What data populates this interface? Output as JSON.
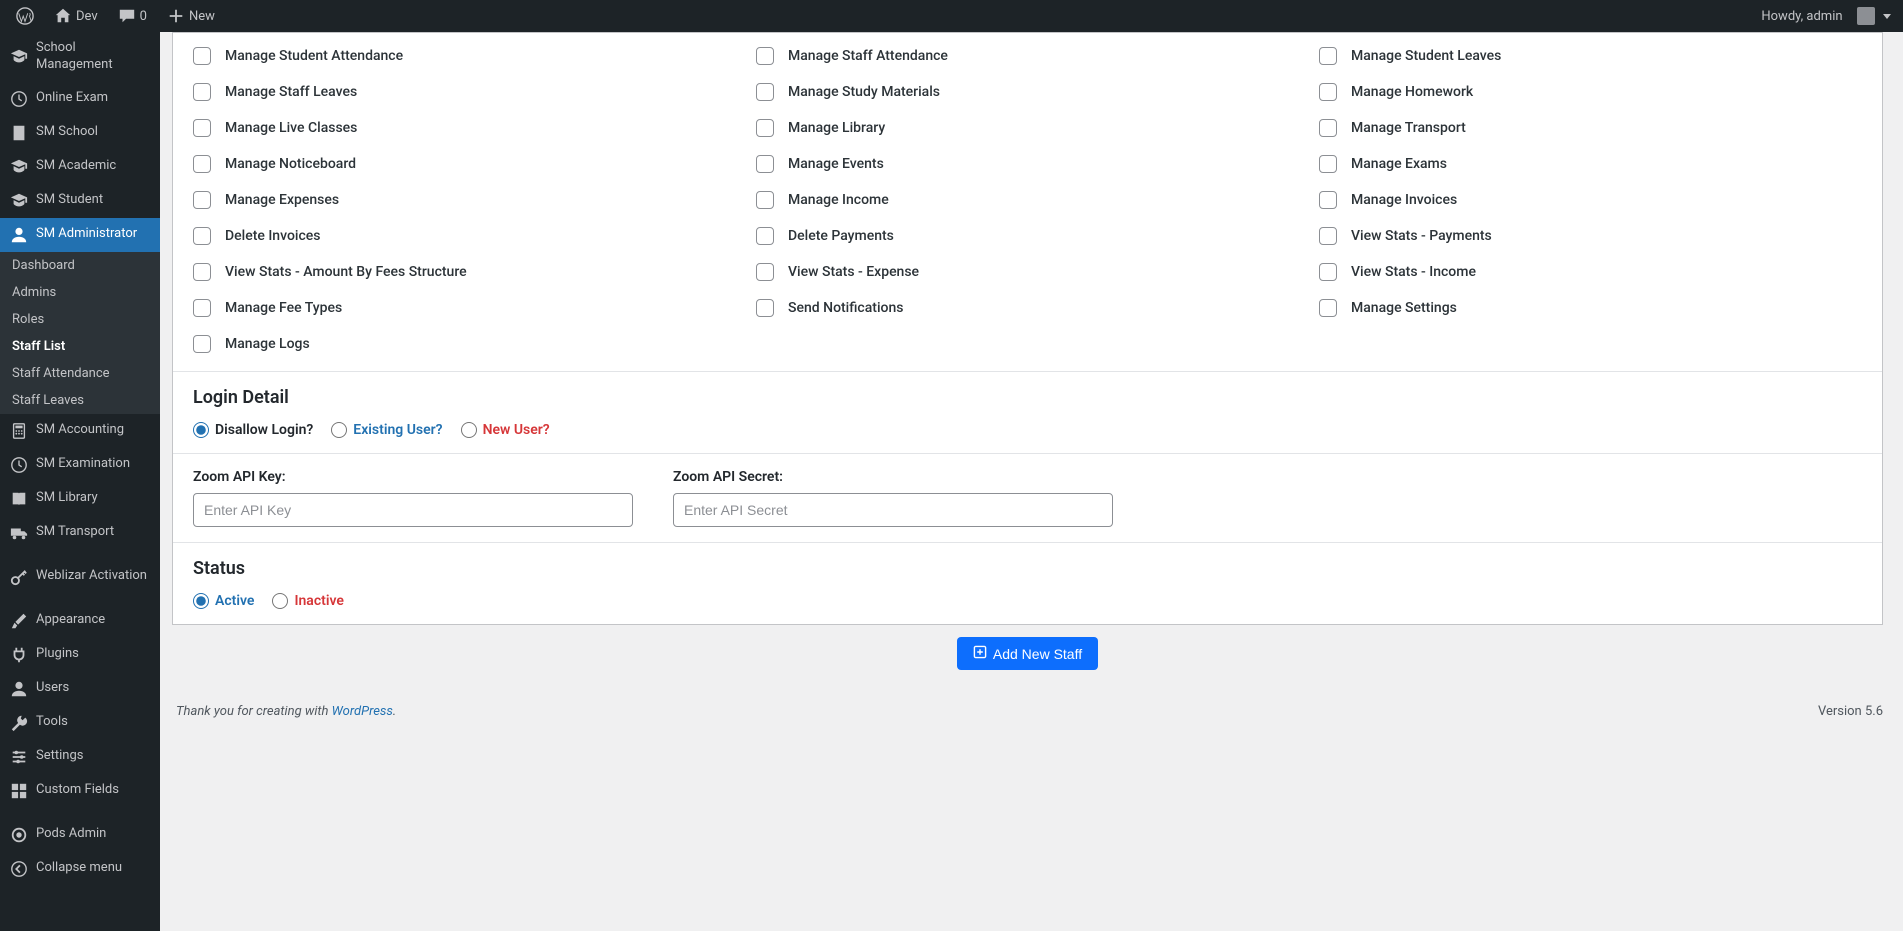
{
  "topbar": {
    "site_name": "Dev",
    "comments_count": "0",
    "new_label": "New",
    "greeting": "Howdy, admin"
  },
  "sidebar": {
    "items": [
      {
        "label": "School Management",
        "icon": "graduation"
      },
      {
        "label": "Online Exam",
        "icon": "clock"
      },
      {
        "label": "SM School",
        "icon": "building"
      },
      {
        "label": "SM Academic",
        "icon": "graduation"
      },
      {
        "label": "SM Student",
        "icon": "graduation"
      },
      {
        "label": "SM Administrator",
        "icon": "user"
      }
    ],
    "submenu": [
      {
        "label": "Dashboard"
      },
      {
        "label": "Admins"
      },
      {
        "label": "Roles"
      },
      {
        "label": "Staff List"
      },
      {
        "label": "Staff Attendance"
      },
      {
        "label": "Staff Leaves"
      }
    ],
    "items2": [
      {
        "label": "SM Accounting",
        "icon": "calc"
      },
      {
        "label": "SM Examination",
        "icon": "clock"
      },
      {
        "label": "SM Library",
        "icon": "book"
      },
      {
        "label": "SM Transport",
        "icon": "truck"
      },
      {
        "label": "Weblizar Activation",
        "icon": "key"
      },
      {
        "label": "Appearance",
        "icon": "brush"
      },
      {
        "label": "Plugins",
        "icon": "plug"
      },
      {
        "label": "Users",
        "icon": "user"
      },
      {
        "label": "Tools",
        "icon": "wrench"
      },
      {
        "label": "Settings",
        "icon": "sliders"
      },
      {
        "label": "Custom Fields",
        "icon": "grid"
      },
      {
        "label": "Pods Admin",
        "icon": "circle"
      },
      {
        "label": "Collapse menu",
        "icon": "collapse"
      }
    ]
  },
  "permissions": [
    "Manage Student Attendance",
    "Manage Staff Attendance",
    "Manage Student Leaves",
    "Manage Staff Leaves",
    "Manage Study Materials",
    "Manage Homework",
    "Manage Live Classes",
    "Manage Library",
    "Manage Transport",
    "Manage Noticeboard",
    "Manage Events",
    "Manage Exams",
    "Manage Expenses",
    "Manage Income",
    "Manage Invoices",
    "Delete Invoices",
    "Delete Payments",
    "View Stats - Payments",
    "View Stats - Amount By Fees Structure",
    "View Stats - Expense",
    "View Stats - Income",
    "Manage Fee Types",
    "Send Notifications",
    "Manage Settings",
    "Manage Logs"
  ],
  "login_detail": {
    "heading": "Login Detail",
    "options": [
      "Disallow Login?",
      "Existing User?",
      "New User?"
    ]
  },
  "zoom": {
    "key_label": "Zoom API Key:",
    "key_placeholder": "Enter API Key",
    "secret_label": "Zoom API Secret:",
    "secret_placeholder": "Enter API Secret"
  },
  "status": {
    "heading": "Status",
    "options": [
      "Active",
      "Inactive"
    ]
  },
  "button": {
    "add_label": "Add New Staff"
  },
  "footer": {
    "thanks": "Thank you for creating with ",
    "wp": "WordPress",
    "period": ".",
    "version": "Version 5.6"
  }
}
